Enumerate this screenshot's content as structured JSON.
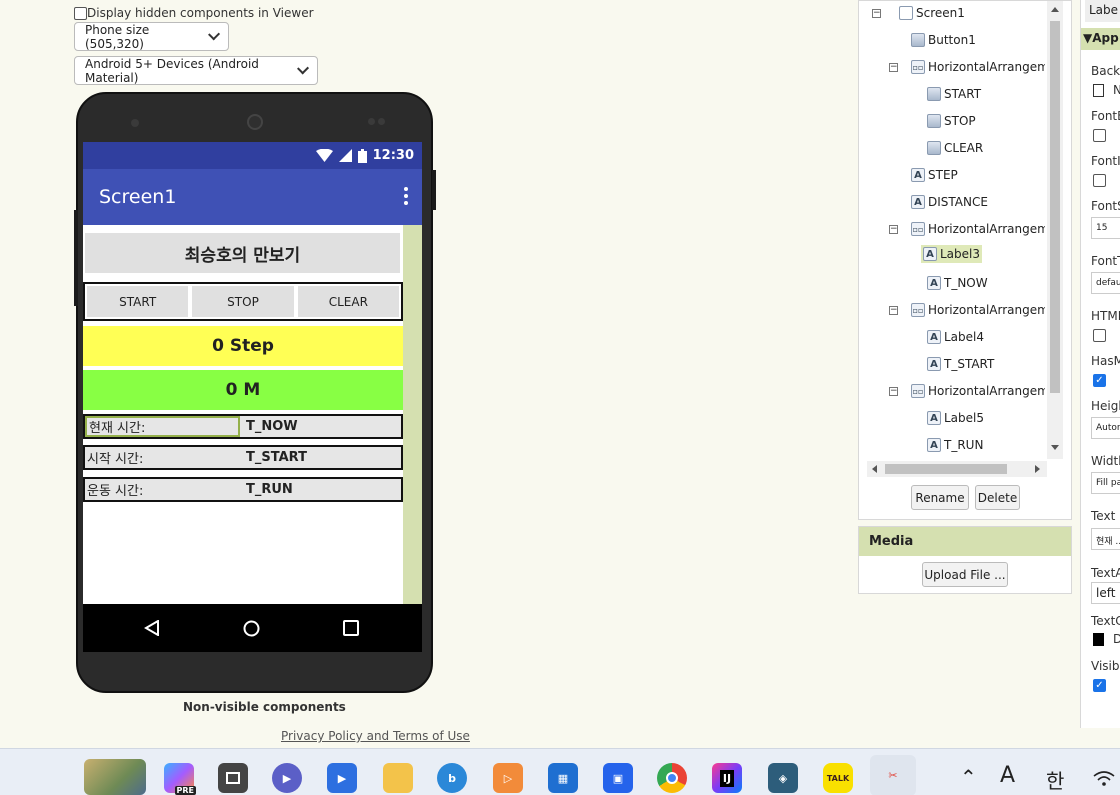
{
  "viewer": {
    "hidden_components_label": "Display hidden components in Viewer",
    "phone_size": "Phone size (505,320)",
    "theme": "Android 5+ Devices (Android Material)",
    "non_visible_label": "Non-visible components",
    "privacy_link": "Privacy Policy and Terms of Use"
  },
  "phone": {
    "time": "12:30",
    "app_title": "Screen1",
    "title_label": "최승호의 만보기",
    "buttons": [
      "START",
      "STOP",
      "CLEAR"
    ],
    "step_text": "0 Step",
    "distance_text": "0 M",
    "rows": [
      {
        "key": "현재 시간:",
        "value": "T_NOW"
      },
      {
        "key": "시작 시간:",
        "value": "T_START"
      },
      {
        "key": "운동 시간:",
        "value": "T_RUN"
      }
    ]
  },
  "tree": {
    "nodes": [
      {
        "label": "Screen1",
        "type": "screen"
      },
      {
        "label": "Button1",
        "type": "button"
      },
      {
        "label": "HorizontalArrangeme",
        "type": "ha"
      },
      {
        "label": "START",
        "type": "button"
      },
      {
        "label": "STOP",
        "type": "button"
      },
      {
        "label": "CLEAR",
        "type": "button"
      },
      {
        "label": "STEP",
        "type": "label"
      },
      {
        "label": "DISTANCE",
        "type": "label"
      },
      {
        "label": "HorizontalArrangeme",
        "type": "ha"
      },
      {
        "label": "Label3",
        "type": "label"
      },
      {
        "label": "T_NOW",
        "type": "label"
      },
      {
        "label": "HorizontalArrangeme",
        "type": "ha"
      },
      {
        "label": "Label4",
        "type": "label"
      },
      {
        "label": "T_START",
        "type": "label"
      },
      {
        "label": "HorizontalArrangeme",
        "type": "ha"
      },
      {
        "label": "Label5",
        "type": "label"
      },
      {
        "label": "T_RUN",
        "type": "label"
      }
    ],
    "rename_label": "Rename",
    "delete_label": "Delete"
  },
  "media": {
    "title": "Media",
    "upload_label": "Upload File ..."
  },
  "properties": {
    "component": "Labe",
    "section": "App",
    "items": [
      {
        "label": "Backg",
        "value": "N"
      },
      {
        "label": "FontB"
      },
      {
        "label": "FontI"
      },
      {
        "label": "FontS",
        "value": "15"
      },
      {
        "label": "FontT",
        "value": "defau"
      },
      {
        "label": "HTML"
      },
      {
        "label": "HasM"
      },
      {
        "label": "Heigh",
        "value": "Autor"
      },
      {
        "label": "Width",
        "value": "Fill pa"
      },
      {
        "label": "Text",
        "value": "현재 ..."
      },
      {
        "label": "TextA",
        "value": "left :"
      },
      {
        "label": "TextC",
        "value": "D"
      },
      {
        "label": "Visibl"
      }
    ]
  },
  "taskbar": {
    "kakao_label": "TALK",
    "intellij_label": "IJ",
    "pre_badge": "PRE",
    "ime_label": "A",
    "ime_lang": "한"
  }
}
